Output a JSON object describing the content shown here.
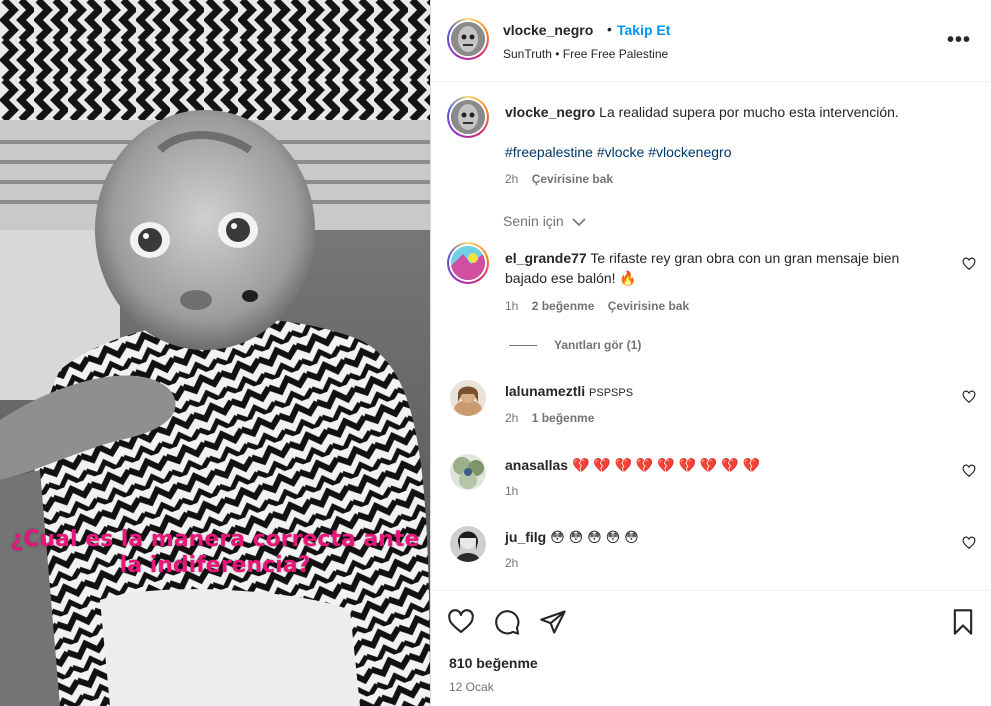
{
  "post": {
    "overlay_caption_line1": "¿Cual es la manera correcta ante",
    "overlay_caption_line2": "la indiferencia?",
    "overlay_color": "#e8157a"
  },
  "header": {
    "username": "vlocke_negro",
    "dot": "•",
    "follow_label": "Takip Et",
    "subtitle": "SunTruth • Free Free Palestine",
    "more_icon": "more-horizontal-icon",
    "more_glyph": "•••"
  },
  "caption": {
    "username": "vlocke_negro",
    "text": "La realidad supera por mucho esta intervención.",
    "hashtags": "#freepalestine #vlocke #vlockenegro",
    "time": "2h",
    "translate_label": "Çevirisine bak"
  },
  "filter": {
    "label": "Senin için",
    "icon": "chevron-down-icon"
  },
  "comments": [
    {
      "username": "el_grande77",
      "text_line1": "Te rifaste rey gran obra con un gran mensaje bien",
      "text_line2": "bajado ese balón! 🔥",
      "time": "1h",
      "likes": "2 beğenme",
      "translate_label": "Çevirisine bak",
      "replies_label": "Yanıtları gör (1)"
    },
    {
      "username": "lalunameztli",
      "text": "PSPSPS",
      "time": "2h",
      "likes": "1 beğenme"
    },
    {
      "username": "anasallas",
      "text": "💔 💔 💔 💔 💔 💔 💔 💔 💔",
      "time": "1h"
    },
    {
      "username": "ju_filg",
      "text": "😳 😳 😳 😳 😳",
      "time": "2h"
    }
  ],
  "actions": {
    "like_icon": "heart-icon",
    "comment_icon": "comment-icon",
    "share_icon": "share-icon",
    "save_icon": "bookmark-icon",
    "likes_count": "810 beğenme",
    "date": "12 Ocak"
  },
  "colors": {
    "accent": "#0095f6",
    "hashtag": "#00376b",
    "muted": "#737373"
  }
}
